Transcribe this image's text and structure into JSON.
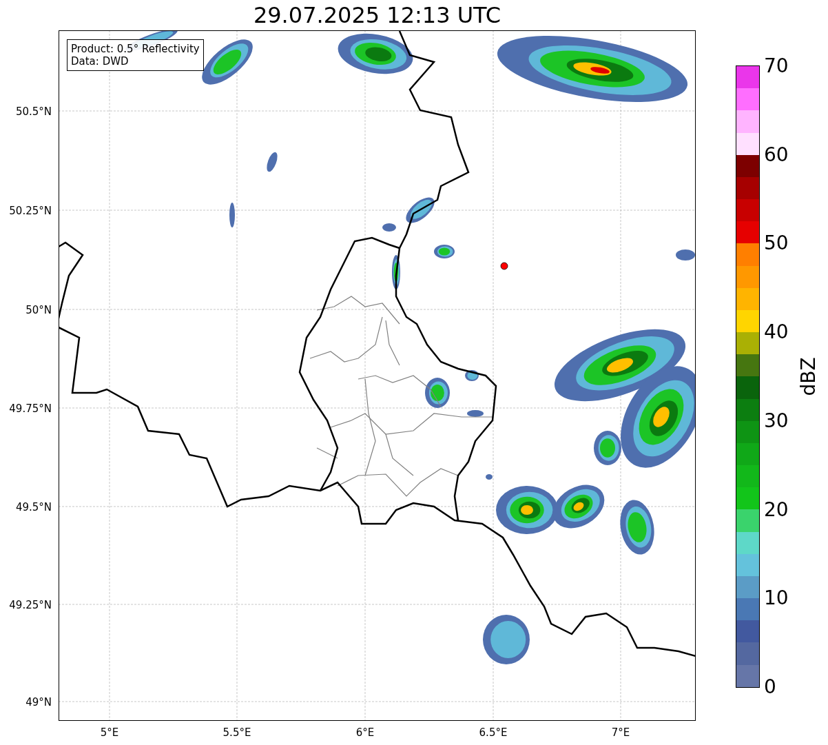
{
  "title": "29.07.2025 12:13 UTC",
  "info_box": {
    "lines": [
      "Product: 0.5° Reflectivity",
      "Data: DWD"
    ]
  },
  "map": {
    "yticks": [
      "50.5°N",
      "50.25°N",
      "50°N",
      "49.75°N",
      "49.5°N",
      "49.25°N",
      "49°N"
    ],
    "xticks": [
      "5°E",
      "5.5°E",
      "6°E",
      "6.5°E",
      "7°E"
    ]
  },
  "colorbar": {
    "label": "dBZ",
    "ticks": [
      "70",
      "60",
      "50",
      "40",
      "30",
      "20",
      "10",
      "0"
    ],
    "bins": [
      {
        "color": "#ea36ea"
      },
      {
        "color": "#ff6eff"
      },
      {
        "color": "#ffb4ff"
      },
      {
        "color": "#ffe0ff"
      },
      {
        "color": "#7d0000"
      },
      {
        "color": "#a60000"
      },
      {
        "color": "#c80000"
      },
      {
        "color": "#e60000"
      },
      {
        "color": "#ff7f00"
      },
      {
        "color": "#ff9800"
      },
      {
        "color": "#ffb400"
      },
      {
        "color": "#ffd500"
      },
      {
        "color": "#aab004"
      },
      {
        "color": "#467610"
      },
      {
        "color": "#0a640c"
      },
      {
        "color": "#0c7e10"
      },
      {
        "color": "#0e9414"
      },
      {
        "color": "#10a818"
      },
      {
        "color": "#12b81a"
      },
      {
        "color": "#12c51a"
      },
      {
        "color": "#3ad36c"
      },
      {
        "color": "#5ed8c8"
      },
      {
        "color": "#64c2dc"
      },
      {
        "color": "#5b9cc6"
      },
      {
        "color": "#4a78b4"
      },
      {
        "color": "#42599f"
      },
      {
        "color": "#5468a0"
      },
      {
        "color": "#6676a8"
      }
    ]
  }
}
